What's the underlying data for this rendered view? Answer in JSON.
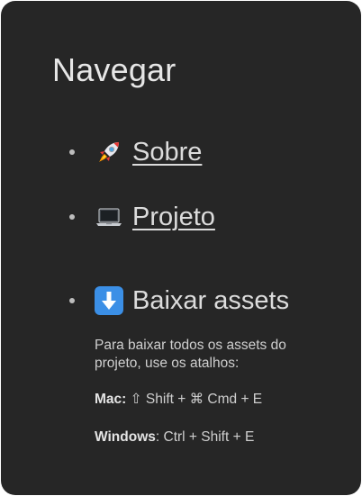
{
  "nav": {
    "title": "Navegar",
    "items": [
      {
        "icon": "rocket-icon",
        "label": "Sobre",
        "link": true
      },
      {
        "icon": "laptop-icon",
        "label": "Projeto",
        "link": true
      },
      {
        "icon": "down-arrow-icon",
        "label": "Baixar assets",
        "link": false
      }
    ],
    "download": {
      "description": "Para baixar todos os assets do projeto, use os atalhos:",
      "mac_label": "Mac:",
      "mac_shortcut": "⇧ Shift + ⌘ Cmd + E",
      "windows_label": "Windows",
      "windows_shortcut": ": Ctrl + Shift + E"
    }
  },
  "colors": {
    "background": "#262626",
    "text": "#dcdcdc",
    "download_icon": "#3b8fe6"
  }
}
